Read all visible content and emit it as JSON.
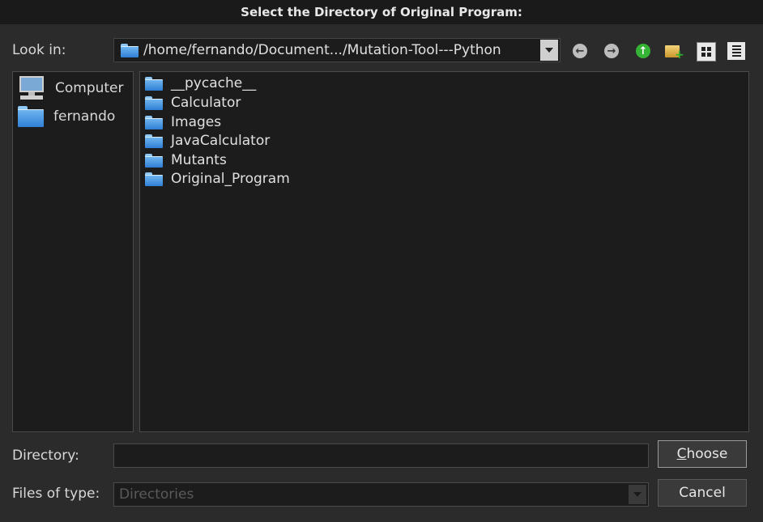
{
  "dialog": {
    "title": "Select the Directory of Original Program:"
  },
  "look_in": {
    "label": "Look in:",
    "path": "/home/fernando/Document.../Mutation-Tool---Python"
  },
  "toolbar": {
    "icons": [
      "back-icon",
      "forward-icon",
      "up-folder-icon",
      "new-folder-icon",
      "icon-view-icon",
      "list-view-icon"
    ]
  },
  "sidebar": {
    "items": [
      {
        "label": "Computer",
        "icon": "computer-icon"
      },
      {
        "label": "fernando",
        "icon": "folder-icon"
      }
    ]
  },
  "files": {
    "items": [
      {
        "name": "__pycache__"
      },
      {
        "name": "Calculator"
      },
      {
        "name": "Images"
      },
      {
        "name": "JavaCalculator"
      },
      {
        "name": "Mutants"
      },
      {
        "name": "Original_Program"
      }
    ]
  },
  "directory": {
    "label": "Directory:",
    "value": ""
  },
  "files_of_type": {
    "label": "Files of type:",
    "value": "Directories"
  },
  "buttons": {
    "choose_first": "C",
    "choose_rest": "hoose",
    "cancel": "Cancel"
  },
  "colors": {
    "background": "#2b2b2b",
    "panel": "#1c1c1c",
    "folder": "#4a9be8",
    "up_arrow": "#2fb02f"
  }
}
